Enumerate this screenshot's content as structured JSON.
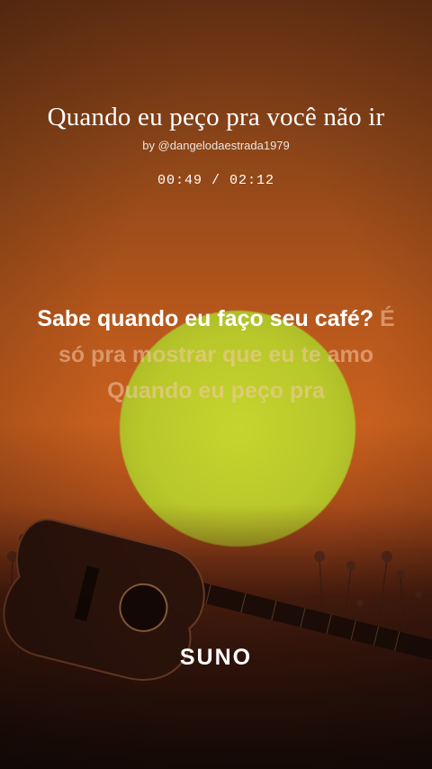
{
  "song": {
    "title": "Quando eu peço pra você não ir",
    "byline": "by @dangelodaestrada1979",
    "time_display": "00:49 / 02:12"
  },
  "lyrics": {
    "sung": "Sabe quando eu faço seu café?",
    "upcoming": "É só pra mostrar que eu te amo Quando eu peço pra"
  },
  "branding": {
    "logo_text": "SUNO"
  },
  "colors": {
    "background_top": "#6b3314",
    "background_mid": "#c8601e",
    "sun": "#c6d52e",
    "lyric_active": "#ffffff",
    "lyric_upcoming": "#f5c8aa"
  }
}
